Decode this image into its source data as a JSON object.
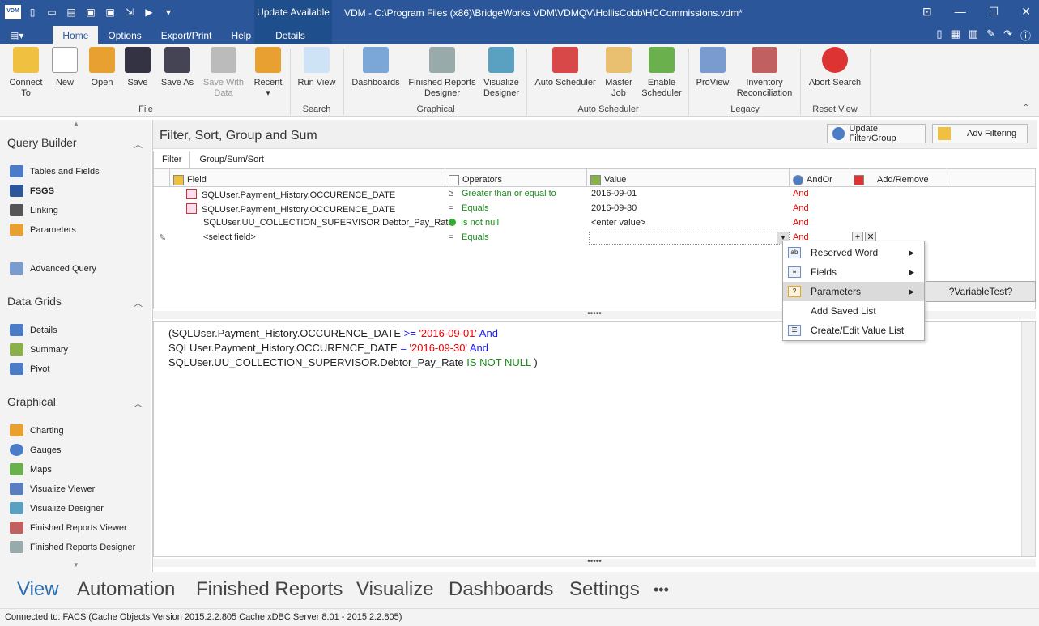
{
  "app": {
    "logo": "VDM",
    "title": "VDM - C:\\Program Files (x86)\\BridgeWorks VDM\\VDMQV\\HollisCobb\\HCCommissions.vdm*",
    "context_tab_title": "Update Available"
  },
  "tabs": [
    "Home",
    "Options",
    "Export/Print",
    "Help",
    "Details"
  ],
  "ribbon": {
    "buttons": [
      "Connect To",
      "New",
      "Open",
      "Save",
      "Save As",
      "Save With Data",
      "Recent",
      "Run View",
      "Dashboards",
      "Finished Reports Designer",
      "Visualize Designer",
      "Auto Scheduler",
      "Master Job",
      "Enable Scheduler",
      "ProView",
      "Inventory Reconciliation",
      "Abort Search"
    ],
    "groups": [
      "File",
      "Search",
      "Graphical",
      "Auto Scheduler",
      "Legacy",
      "Reset View"
    ]
  },
  "sidebar": {
    "sections": [
      "Query Builder",
      "Data Grids",
      "Graphical"
    ],
    "query_builder": [
      "Tables and Fields",
      "FSGS",
      "Linking",
      "Parameters",
      "Advanced Query"
    ],
    "data_grids": [
      "Details",
      "Summary",
      "Pivot"
    ],
    "graphical": [
      "Charting",
      "Gauges",
      "Maps",
      "Visualize Viewer",
      "Visualize Designer",
      "Finished Reports Viewer",
      "Finished Reports Designer"
    ]
  },
  "panel": {
    "title": "Filter, Sort, Group and Sum",
    "update_button": "Update Filter/Group",
    "adv_button": "Adv Filtering",
    "subtabs": [
      "Filter",
      "Group/Sum/Sort"
    ]
  },
  "grid": {
    "columns": [
      "Field",
      "Operators",
      "Value",
      "AndOr",
      "Add/Remove"
    ],
    "rows": [
      {
        "field": "SQLUser.Payment_History.OCCURENCE_DATE",
        "operator": "Greater than or equal to",
        "value": "2016-09-01",
        "andor": "And"
      },
      {
        "field": "SQLUser.Payment_History.OCCURENCE_DATE",
        "operator": "Equals",
        "value": "2016-09-30",
        "andor": "And"
      },
      {
        "field": "SQLUser.UU_COLLECTION_SUPERVISOR.Debtor_Pay_Rate",
        "operator": "Is not null",
        "value": "<enter value>",
        "andor": "And"
      },
      {
        "field": "<select field>",
        "operator": "Equals",
        "value": "",
        "andor": "And"
      }
    ]
  },
  "sql": {
    "l1": {
      "a": "(SQLUser.Payment_History.OCCURENCE_DATE ",
      "op": ">=",
      "s": " '2016-09-01' ",
      "k": "And"
    },
    "l2": {
      "a": "SQLUser.Payment_History.OCCURENCE_DATE ",
      "op": "=",
      "s": " '2016-09-30' ",
      "k": "And"
    },
    "l3": {
      "a": "SQLUser.UU_COLLECTION_SUPERVISOR.Debtor_Pay_Rate ",
      "n": "IS NOT NULL",
      "e": " )"
    }
  },
  "context_menu": [
    "Reserved Word",
    "Fields",
    "Parameters",
    "Add Saved List",
    "Create/Edit Value List"
  ],
  "submenu": "?VariableTest?",
  "bottom_nav": [
    "View",
    "Automation",
    "Finished Reports",
    "Visualize",
    "Dashboards",
    "Settings",
    "•••"
  ],
  "status": "Connected to: FACS (Cache Objects Version 2015.2.2.805 Cache xDBC Server 8.01 - 2015.2.2.805)",
  "colors": {
    "title_bar": "#2b579a",
    "accent": "#2b6cb0",
    "and_text": "#e00000",
    "operator_text": "#1b8a1b"
  }
}
